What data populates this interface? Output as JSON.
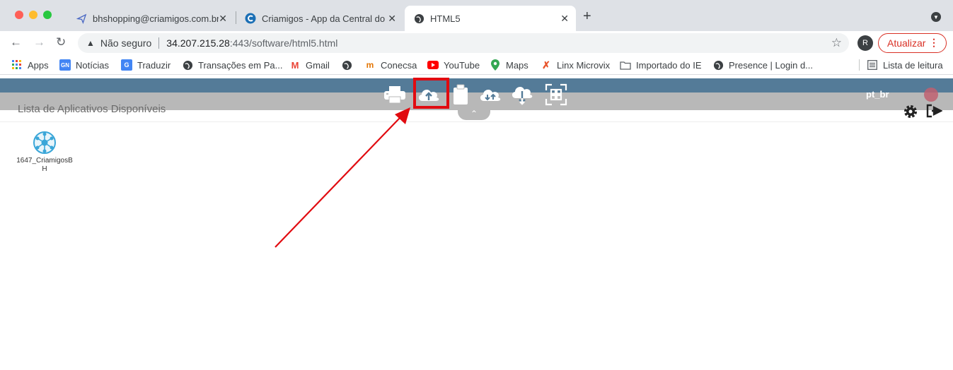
{
  "browser": {
    "tabs": [
      {
        "title": "bhshopping@criamigos.com.br",
        "favicon": "send-icon",
        "active": false
      },
      {
        "title": "Criamigos - App da Central do",
        "favicon": "criamigos-icon",
        "active": false
      },
      {
        "title": "HTML5",
        "favicon": "globe-icon",
        "active": true
      }
    ],
    "new_tab": "+",
    "security_label": "Não seguro",
    "url_host": "34.207.215.28",
    "url_path": ":443/software/html5.html",
    "profile_initial": "R",
    "update_label": "Atualizar"
  },
  "bookmarks": {
    "items": [
      {
        "label": "Apps",
        "icon": "apps-grid-icon"
      },
      {
        "label": "Notícias",
        "icon": "news-icon"
      },
      {
        "label": "Traduzir",
        "icon": "translate-icon"
      },
      {
        "label": "Transações em Pa...",
        "icon": "globe-icon"
      },
      {
        "label": "Gmail",
        "icon": "gmail-icon"
      },
      {
        "label": "",
        "icon": "globe-icon"
      },
      {
        "label": "Conecsa",
        "icon": "conecsa-icon"
      },
      {
        "label": "YouTube",
        "icon": "youtube-icon"
      },
      {
        "label": "Maps",
        "icon": "maps-pin-icon"
      },
      {
        "label": "Linx Microvix",
        "icon": "linx-icon"
      },
      {
        "label": "Importado do IE",
        "icon": "folder-icon"
      },
      {
        "label": "Presence | Login d...",
        "icon": "globe-icon"
      }
    ],
    "reading_list": "Lista de leitura"
  },
  "app_page": {
    "title": "Lista de Aplicativos Disponíveis",
    "language": "pt_br",
    "toolbar_icons": [
      "printer-icon",
      "cloud-upload-icon",
      "clipboard-icon",
      "cloud-transfer-icon",
      "cloud-download-icon",
      "fullscreen-icon"
    ],
    "highlighted_tool": "cloud-upload-icon",
    "apps": [
      {
        "label": "1647_CriamigosBH",
        "icon": "network-hub-icon"
      }
    ]
  },
  "colors": {
    "header_blue": "#547b98",
    "toolbar_gray": "#b8b8b8",
    "annotation_red": "#e10b10",
    "app_icon_blue": "#3aa6d8"
  }
}
